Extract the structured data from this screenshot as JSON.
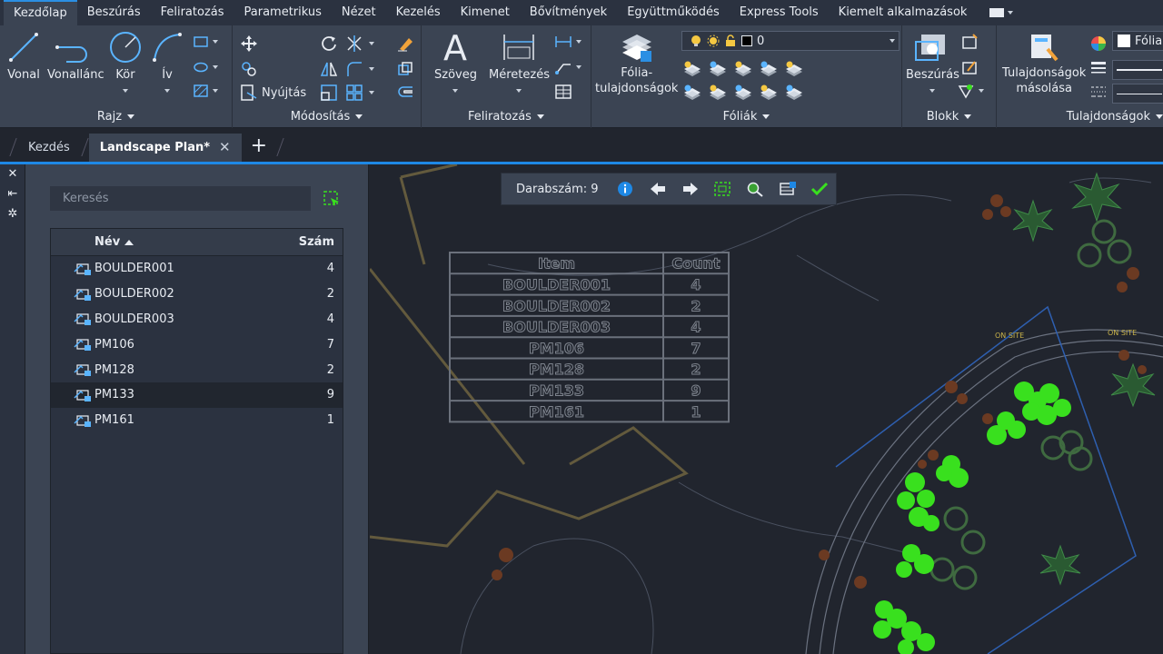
{
  "ribbon_tabs": [
    "Kezdőlap",
    "Beszúrás",
    "Feliratozás",
    "Parametrikus",
    "Nézet",
    "Kezelés",
    "Kimenet",
    "Bővítmények",
    "Együttműködés",
    "Express Tools",
    "Kiemelt alkalmazások"
  ],
  "ribbon": {
    "draw": {
      "title": "Rajz",
      "line": "Vonal",
      "polyline": "Vonallánc",
      "circle": "Kör",
      "arc": "Ív"
    },
    "modify": {
      "title": "Módosítás",
      "stretch": "Nyújtás"
    },
    "annotation": {
      "title": "Feliratozás",
      "text": "Szöveg",
      "dimension": "Méretezés"
    },
    "layers": {
      "title": "Fóliák",
      "props_line1": "Fólia-",
      "props_line2": "tulajdonságok",
      "current_layer": "0"
    },
    "block": {
      "title": "Blokk",
      "insert": "Beszúrás"
    },
    "properties": {
      "title": "Tulajdonságok",
      "match_line1": "Tulajdonságok",
      "match_line2": "másolása",
      "color_label": "Fólia"
    }
  },
  "doc_tabs": {
    "start": "Kezdés",
    "active": "Landscape Plan*",
    "close": "✕",
    "new": "+"
  },
  "palette": {
    "strip": {
      "close": "✕",
      "pin": "⇤",
      "settings": "✲"
    },
    "search_placeholder": "Keresés",
    "col_name": "Név",
    "col_count": "Szám",
    "rows": [
      {
        "name": "BOULDER001",
        "count": "4"
      },
      {
        "name": "BOULDER002",
        "count": "2"
      },
      {
        "name": "BOULDER003",
        "count": "4"
      },
      {
        "name": "PM106",
        "count": "7"
      },
      {
        "name": "PM128",
        "count": "2"
      },
      {
        "name": "PM133",
        "count": "9"
      },
      {
        "name": "PM161",
        "count": "1"
      }
    ],
    "selected_row": 5
  },
  "count_toolbar": {
    "label": "Darabszám:",
    "value": "9"
  },
  "drawing_table": {
    "header": [
      "Item",
      "Count"
    ],
    "rows": [
      [
        "BOULDER001",
        "4"
      ],
      [
        "BOULDER002",
        "2"
      ],
      [
        "BOULDER003",
        "4"
      ],
      [
        "PM106",
        "7"
      ],
      [
        "PM128",
        "2"
      ],
      [
        "PM133",
        "9"
      ],
      [
        "PM161",
        "1"
      ]
    ]
  },
  "drawing_labels": {
    "on_site_1": "ON SITE",
    "on_site_2": "ON SITE"
  },
  "colors": {
    "accent": "#1e88e5",
    "highlight_green": "#39e01e",
    "ribbon": "#3b4453",
    "canvas": "#21252e"
  }
}
